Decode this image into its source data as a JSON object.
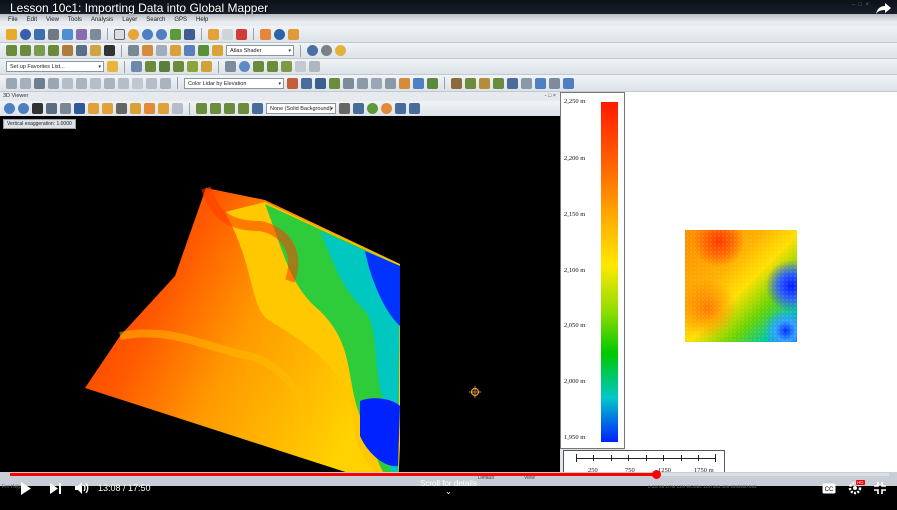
{
  "video": {
    "title": "Lesson 10c1: Importing Data into Global Mapper",
    "current_time": "13:08",
    "duration": "17:50",
    "time_display": "13:08 / 17:50",
    "progress": 0.735,
    "scroll_hint": "Scroll for details",
    "hd_badge": "HD"
  },
  "app": {
    "menu": [
      "File",
      "Edit",
      "View",
      "Tools",
      "Analysis",
      "Layer",
      "Search",
      "GPS",
      "Help"
    ],
    "shader_dropdown": "Atlas Shader",
    "favorites_dropdown": "Set up Favorites List...",
    "lidar_dropdown": "Color Lidar by Elevation",
    "status_left": "For Help",
    "status_labels": [
      "Default",
      "View"
    ],
    "status_right": "0.23728 UTM 13N WGS84 1147383.405 4093900.593"
  },
  "viewer": {
    "title": "3D Viewer",
    "window_buttons": "- □ ×",
    "background_dropdown": "None (Solid Background)",
    "vertical_exaggeration": "Vertical exaggeration: 1.0000"
  },
  "legend": {
    "labels": [
      "2,250 m",
      "2,200 m",
      "2,150 m",
      "2,100 m",
      "2,050 m",
      "2,000 m",
      "1,950 m"
    ]
  },
  "scale_bar": {
    "labels": [
      "250",
      "750",
      "1250",
      "1750 m"
    ]
  },
  "colors": {
    "progress": "#ff0000",
    "terrain_high": "#ff2a00",
    "terrain_mid": "#ffd000",
    "terrain_low": "#0022ff"
  }
}
